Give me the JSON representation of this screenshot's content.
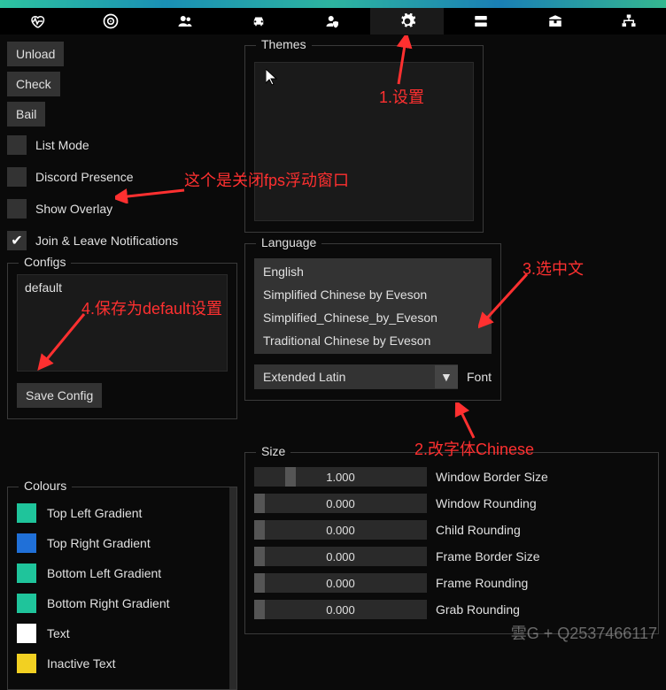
{
  "tabs": [
    {
      "name": "heart"
    },
    {
      "name": "target"
    },
    {
      "name": "people"
    },
    {
      "name": "car"
    },
    {
      "name": "user-shield"
    },
    {
      "name": "gear"
    },
    {
      "name": "server"
    },
    {
      "name": "box"
    },
    {
      "name": "network"
    }
  ],
  "buttons": {
    "unload": "Unload",
    "check": "Check",
    "bail": "Bail",
    "save_config": "Save Config"
  },
  "checks": {
    "list_mode": "List Mode",
    "discord": "Discord Presence",
    "overlay": "Show Overlay",
    "join_leave": "Join & Leave Notifications"
  },
  "sections": {
    "configs": "Configs",
    "themes": "Themes",
    "language": "Language",
    "colours": "Colours",
    "size": "Size",
    "font": "Font"
  },
  "configs": {
    "value": "default"
  },
  "languages": [
    "English",
    "Simplified Chinese by Eveson",
    "Simplified_Chinese_by_Eveson",
    "Traditional Chinese by Eveson"
  ],
  "font_select": "Extended Latin",
  "colours": [
    {
      "hex": "#1fc49b",
      "label": "Top Left Gradient"
    },
    {
      "hex": "#2070d8",
      "label": "Top Right Gradient"
    },
    {
      "hex": "#1fc49b",
      "label": "Bottom Left Gradient"
    },
    {
      "hex": "#1fc49b",
      "label": "Bottom Right Gradient"
    },
    {
      "hex": "#ffffff",
      "label": "Text"
    },
    {
      "hex": "#f2d022",
      "label": "Inactive Text"
    }
  ],
  "sizes": [
    {
      "value": "1.000",
      "label": "Window Border Size",
      "pos": 18
    },
    {
      "value": "0.000",
      "label": "Window Rounding",
      "pos": 0
    },
    {
      "value": "0.000",
      "label": "Child Rounding",
      "pos": 0
    },
    {
      "value": "0.000",
      "label": "Frame Border Size",
      "pos": 0
    },
    {
      "value": "0.000",
      "label": "Frame Rounding",
      "pos": 0
    },
    {
      "value": "0.000",
      "label": "Grab Rounding",
      "pos": 0
    }
  ],
  "annotations": {
    "a1": "1.设置",
    "a2": "这个是关闭fps浮动窗口",
    "a3": "3.选中文",
    "a4": "4.保存为default设置",
    "a5": "2.改字体Chinese"
  },
  "watermark": "雲G + Q2537466117"
}
